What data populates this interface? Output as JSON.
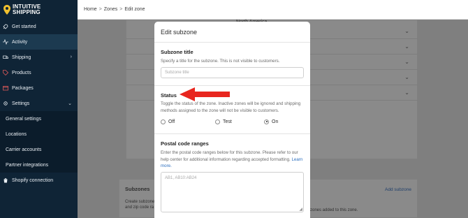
{
  "brand": {
    "line1": "INTUITIVE",
    "line2": "SHIPPING",
    "accent": "#f2c12e"
  },
  "sidebar": {
    "items": [
      {
        "label": "Get started",
        "icon": "rocket-icon"
      },
      {
        "label": "Activity",
        "icon": "activity-icon",
        "active": true
      },
      {
        "label": "Shipping",
        "icon": "truck-icon",
        "chevron": ">"
      },
      {
        "label": "Products",
        "icon": "tag-icon"
      },
      {
        "label": "Packages",
        "icon": "box-icon"
      },
      {
        "label": "Settings",
        "icon": "gear-icon",
        "chevron": "v"
      }
    ],
    "sub_items": [
      {
        "label": "General settings"
      },
      {
        "label": "Locations"
      },
      {
        "label": "Carrier accounts"
      },
      {
        "label": "Partner integrations"
      }
    ],
    "bottom_item": {
      "label": "Shopify connection",
      "icon": "shopify-icon"
    }
  },
  "breadcrumb": {
    "home": "Home",
    "zones": "Zones",
    "current": "Edit zone",
    "separator": ">"
  },
  "background": {
    "top_row_text": "North America",
    "subzones_title": "Subzones",
    "subzones_desc_1": "Create subzone",
    "subzones_desc_2": "and zip code ra",
    "add_subzone": "Add subzone",
    "zones_note": "zones added to this zone."
  },
  "modal": {
    "title": "Edit subzone",
    "subzone_title": {
      "heading": "Subzone title",
      "description": "Specify a title for the subzone. This is not visible to customers.",
      "placeholder": "Subzone title"
    },
    "status": {
      "heading": "Status",
      "description": "Toggle the status of the zone. Inactive zones will be ignored and shipping methods assigned to the zone will not be visible to customers.",
      "options": [
        {
          "label": "Off",
          "selected": false
        },
        {
          "label": "Test",
          "selected": false
        },
        {
          "label": "On",
          "selected": true
        }
      ]
    },
    "postal": {
      "heading": "Postal code ranges",
      "description": "Enter the postal code ranges below for this subzone. Please refer to our help center for additional information regarding accepted formatting.",
      "link": "Learn more.",
      "placeholder": "AB1, AB10:AB24"
    }
  },
  "colors": {
    "sidebar_bg": "#0f2436",
    "arrow": "#e8261f",
    "link": "#2c6fbf"
  }
}
